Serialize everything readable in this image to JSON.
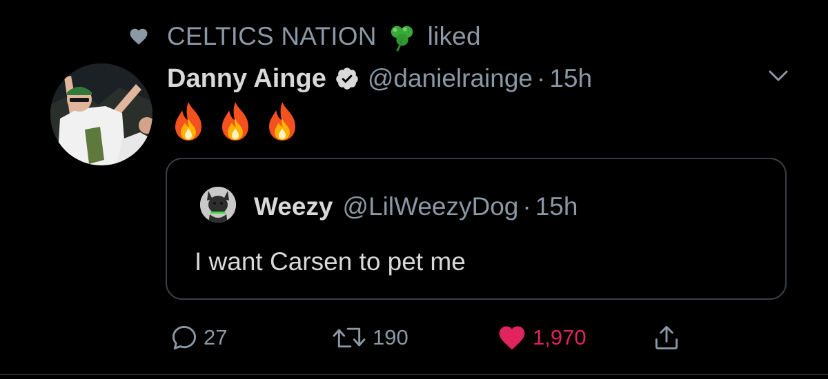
{
  "colors": {
    "background": "#000000",
    "secondary_text": "#8b98a5",
    "primary_text": "#d9d9d9",
    "like_red": "#e0245e",
    "border": "#3a3f45"
  },
  "context": {
    "icon": "heart-icon",
    "account": "CELTICS NATION",
    "emoji": "shamrock",
    "action": "liked"
  },
  "tweet": {
    "display_name": "Danny Ainge",
    "verified": true,
    "handle": "@danielrainge",
    "separator": "·",
    "time": "15h",
    "body_emoji": [
      "fire",
      "fire",
      "fire"
    ]
  },
  "quoted": {
    "display_name": "Weezy",
    "handle": "@LilWeezyDog",
    "separator": "·",
    "time": "15h",
    "text": "I want Carsen to pet me"
  },
  "actions": {
    "reply": {
      "icon": "reply-icon",
      "count": "27"
    },
    "retweet": {
      "icon": "retweet-icon",
      "count": "190"
    },
    "like": {
      "icon": "heart-icon",
      "count": "1,970",
      "liked": true
    },
    "share": {
      "icon": "share-icon"
    }
  }
}
